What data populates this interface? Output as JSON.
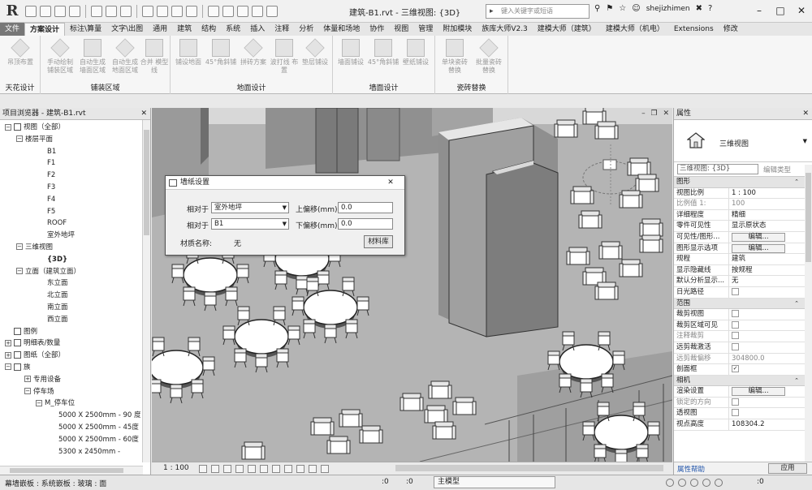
{
  "title_bar": {
    "app_letter": "R",
    "doc_title": "建筑-B1.rvt - 三维视图: {3D}",
    "search_placeholder": "键入关键字或短语",
    "user": "shejizhimen"
  },
  "tabs": [
    {
      "label": "文件"
    },
    {
      "label": "方案设计"
    },
    {
      "label": "标注\\算量"
    },
    {
      "label": "文字\\出图"
    },
    {
      "label": "通用"
    },
    {
      "label": "建筑"
    },
    {
      "label": "结构"
    },
    {
      "label": "系统"
    },
    {
      "label": "插入"
    },
    {
      "label": "注释"
    },
    {
      "label": "分析"
    },
    {
      "label": "体量和场地"
    },
    {
      "label": "协作"
    },
    {
      "label": "视图"
    },
    {
      "label": "管理"
    },
    {
      "label": "附加模块"
    },
    {
      "label": "族库大师V2.3"
    },
    {
      "label": "建模大师（建筑）"
    },
    {
      "label": "建模大师（机电）"
    },
    {
      "label": "Extensions"
    },
    {
      "label": "修改"
    }
  ],
  "ribbon": {
    "groups": [
      {
        "label": "天花设计",
        "buttons": [
          "吊顶布置"
        ]
      },
      {
        "label": "铺装区域",
        "buttons": [
          "手动绘制 铺装区域",
          "自动生成 墙面区域",
          "自动生成 地面区域",
          "合并 模型线"
        ]
      },
      {
        "label": "地面设计",
        "buttons": [
          "铺设地面",
          "45°角斜铺",
          "拼砖方案",
          "波打线 布置",
          "垫层铺设"
        ]
      },
      {
        "label": "墙面设计",
        "buttons": [
          "墙面铺设",
          "45°角斜铺",
          "壁纸铺设"
        ]
      },
      {
        "label": "瓷砖替换",
        "buttons": [
          "单块瓷砖 替换",
          "批量瓷砖 替换"
        ]
      }
    ]
  },
  "project_browser": {
    "title": "项目浏览器 - 建筑-B1.rvt",
    "nodes": [
      {
        "label": "视图（全部）",
        "toggle": "−"
      },
      {
        "label": "楼层平面",
        "toggle": "−"
      },
      {
        "label": "B1"
      },
      {
        "label": "F1"
      },
      {
        "label": "F2"
      },
      {
        "label": "F3"
      },
      {
        "label": "F4"
      },
      {
        "label": "F5"
      },
      {
        "label": "ROOF"
      },
      {
        "label": "室外地坪"
      },
      {
        "label": "三维视图",
        "toggle": "−"
      },
      {
        "label": "{3D}"
      },
      {
        "label": "立面（建筑立面）",
        "toggle": "−"
      },
      {
        "label": "东立面"
      },
      {
        "label": "北立面"
      },
      {
        "label": "南立面"
      },
      {
        "label": "西立面"
      },
      {
        "label": "图例"
      },
      {
        "label": "明细表/数量",
        "toggle": "+"
      },
      {
        "label": "图纸（全部）",
        "toggle": "+"
      },
      {
        "label": "族",
        "toggle": "−"
      },
      {
        "label": "专用设备",
        "toggle": "+"
      },
      {
        "label": "停车场",
        "toggle": "−"
      },
      {
        "label": "M_停车位",
        "toggle": "−"
      },
      {
        "label": "5000 X 2500mm - 90 度"
      },
      {
        "label": "5000 X 2500mm - 45度"
      },
      {
        "label": "5000 X 2500mm - 60度"
      },
      {
        "label": "5300 x 2450mm -"
      }
    ]
  },
  "dialog": {
    "title": "墙纸设置",
    "row1": {
      "label": "相对于",
      "select": "室外地坪",
      "offset_label": "上偏移(mm)",
      "offset": "0.0"
    },
    "row2": {
      "label": "相对于",
      "select": "B1",
      "offset_label": "下偏移(mm)",
      "offset": "0.0"
    },
    "material_label": "材质名称:",
    "material_value": "无",
    "library_button": "材料库"
  },
  "view_bar": {
    "scale": "1 : 100"
  },
  "properties": {
    "title": "属性",
    "type_name": "三维视图",
    "instance": "三维视图: {3D}",
    "edit_type": "编辑类型",
    "sections": [
      {
        "name": "图形",
        "rows": [
          {
            "k": "视图比例",
            "v": "1 : 100"
          },
          {
            "k": "比例值 1:",
            "v": "100",
            "grey": true
          },
          {
            "k": "详细程度",
            "v": "精细"
          },
          {
            "k": "零件可见性",
            "v": "显示原状态"
          },
          {
            "k": "可见性/图形...",
            "v": "编辑...",
            "btn": true
          },
          {
            "k": "图形显示选项",
            "v": "编辑...",
            "btn": true
          },
          {
            "k": "规程",
            "v": "建筑"
          },
          {
            "k": "显示隐藏线",
            "v": "按规程"
          },
          {
            "k": "默认分析显示...",
            "v": "无"
          },
          {
            "k": "日光路径",
            "v": "",
            "cb": true
          }
        ]
      },
      {
        "name": "范围",
        "rows": [
          {
            "k": "裁剪视图",
            "v": "",
            "cb": true
          },
          {
            "k": "裁剪区域可见",
            "v": "",
            "cb": true
          },
          {
            "k": "注释裁剪",
            "v": "",
            "cb": true,
            "greyk": true
          },
          {
            "k": "远剪裁激活",
            "v": "",
            "cb": true
          },
          {
            "k": "远剪裁偏移",
            "v": "304800.0",
            "grey": true,
            "greyk": true
          },
          {
            "k": "剖面框",
            "v": "",
            "cb": true,
            "checked": true
          }
        ]
      },
      {
        "name": "相机",
        "rows": [
          {
            "k": "渲染设置",
            "v": "编辑...",
            "btn": true
          },
          {
            "k": "锁定的方向",
            "v": "",
            "cb": true,
            "greyk": true
          },
          {
            "k": "透视图",
            "v": "",
            "cb": true
          },
          {
            "k": "视点高度",
            "v": "108304.2"
          }
        ]
      }
    ],
    "help": "属性帮助",
    "apply": "应用"
  },
  "status_bar": {
    "text": "幕墙嵌板 : 系统嵌板 : 玻璃 : 面",
    "zero_a": ":0",
    "zero_b": ":0",
    "model": "主模型",
    "zero_c": ":0"
  },
  "colors": {
    "viewport_floor": "#b4b4b4",
    "wall": "#8c8c8c",
    "furniture": "#ffffff"
  }
}
